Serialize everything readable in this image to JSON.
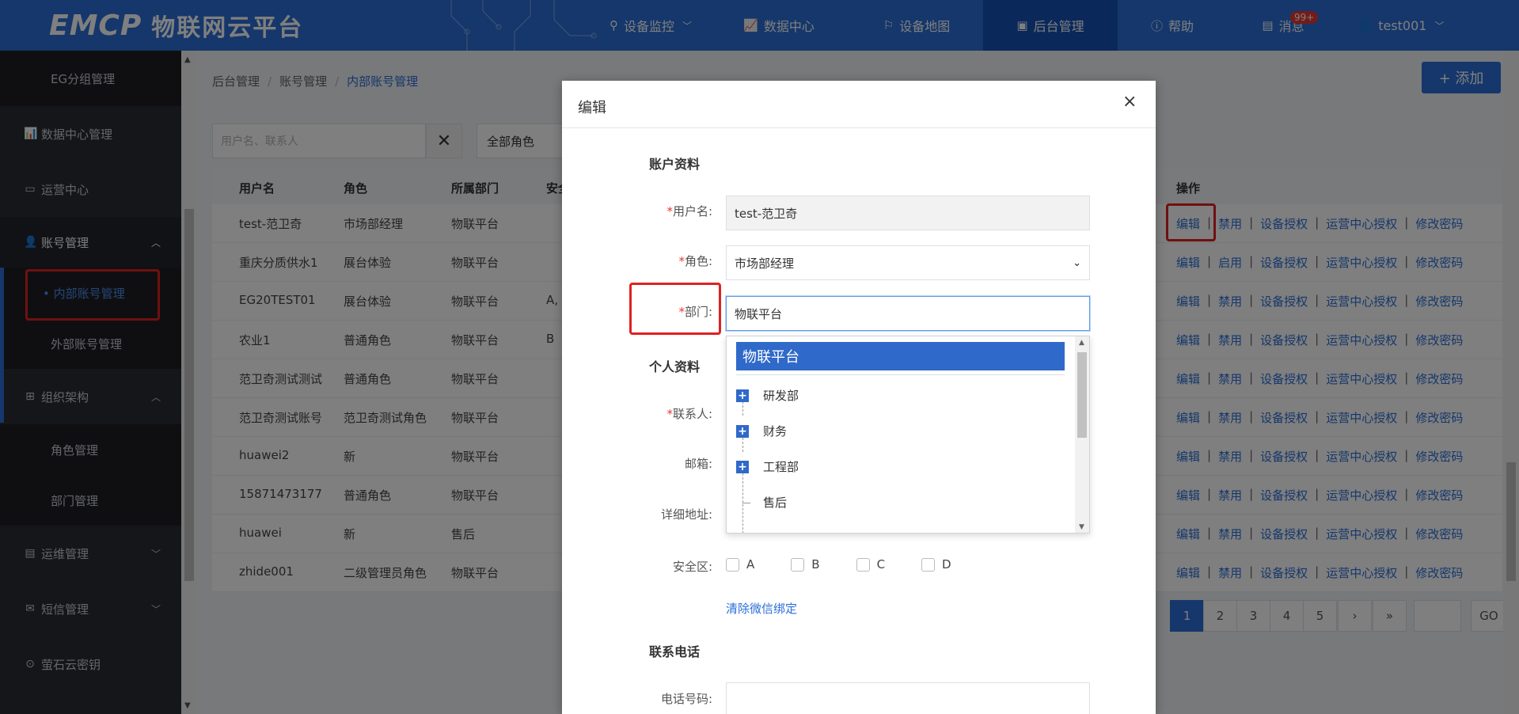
{
  "topbar": {
    "logo": "EMCP",
    "name": "物联网云平台",
    "nav": [
      {
        "label": "设备监控",
        "icon": "location-icon",
        "chevron": true
      },
      {
        "label": "数据中心",
        "icon": "chart-icon"
      },
      {
        "label": "设备地图",
        "icon": "map-pin-icon"
      },
      {
        "label": "后台管理",
        "icon": "monitor-icon",
        "active": true
      },
      {
        "label": "帮助",
        "icon": "help-icon"
      },
      {
        "label": "消息",
        "icon": "message-icon",
        "badge": "99+"
      },
      {
        "label": "test001",
        "icon": "user-icon",
        "chevron": true
      }
    ]
  },
  "sidebar": {
    "items": [
      {
        "label": "EG分组管理",
        "type": "sub"
      },
      {
        "label": "数据中心管理",
        "icon": "chart-icon"
      },
      {
        "label": "运营中心",
        "icon": "monitor-icon"
      },
      {
        "label": "账号管理",
        "icon": "user-icon",
        "expanded": true
      },
      {
        "label": "• 内部账号管理",
        "type": "sub",
        "active": true
      },
      {
        "label": "外部账号管理",
        "type": "sub"
      },
      {
        "label": "组织架构",
        "icon": "org-icon",
        "expanded": true
      },
      {
        "label": "角色管理",
        "type": "sub"
      },
      {
        "label": "部门管理",
        "type": "sub"
      },
      {
        "label": "运维管理",
        "icon": "doc-icon"
      },
      {
        "label": "短信管理",
        "icon": "sms-icon"
      },
      {
        "label": "萤石云密钥",
        "icon": "key-icon"
      }
    ]
  },
  "breadcrumb": [
    "后台管理",
    "账号管理",
    "内部账号管理"
  ],
  "add_button": "+ 添加",
  "search": {
    "placeholder": "用户名、联系人"
  },
  "role_filter": "全部角色",
  "table": {
    "headers": [
      "用户名",
      "角色",
      "所属部门",
      "安全",
      "操作"
    ],
    "rows": [
      {
        "user": "test-范卫奇",
        "role": "市场部经理",
        "dept": "物联平台",
        "sec": "",
        "toggle": "禁用"
      },
      {
        "user": "重庆分质供水1",
        "role": "展台体验",
        "dept": "物联平台",
        "sec": "",
        "toggle": "启用"
      },
      {
        "user": "EG20TEST01",
        "role": "展台体验",
        "dept": "物联平台",
        "sec": "A,",
        "toggle": "禁用"
      },
      {
        "user": "农业1",
        "role": "普通角色",
        "dept": "物联平台",
        "sec": "B",
        "toggle": "禁用"
      },
      {
        "user": "范卫奇测试测试",
        "role": "普通角色",
        "dept": "物联平台",
        "sec": "",
        "toggle": "禁用"
      },
      {
        "user": "范卫奇测试账号",
        "role": "范卫奇测试角色",
        "dept": "物联平台",
        "sec": "",
        "toggle": "禁用"
      },
      {
        "user": "huawei2",
        "role": "新",
        "dept": "物联平台",
        "sec": "",
        "toggle": "禁用"
      },
      {
        "user": "15871473177",
        "role": "普通角色",
        "dept": "物联平台",
        "sec": "",
        "toggle": "禁用"
      },
      {
        "user": "huawei",
        "role": "新",
        "dept": "售后",
        "sec": "",
        "toggle": "禁用"
      },
      {
        "user": "zhide001",
        "role": "二级管理员角色",
        "dept": "物联平台",
        "sec": "",
        "toggle": "禁用"
      }
    ],
    "ops": [
      "编辑",
      "设备授权",
      "运营中心授权",
      "修改密码"
    ]
  },
  "pager": {
    "pages": [
      "1",
      "2",
      "3",
      "4",
      "5",
      "›",
      "»"
    ],
    "current": "1",
    "go": "GO"
  },
  "modal": {
    "title": "编辑",
    "close": "×",
    "section_account": "账户资料",
    "section_personal": "个人资料",
    "section_phone": "联系电话",
    "username_label": "用户名:",
    "username_value": "test-范卫奇",
    "role_label": "角色:",
    "role_value": "市场部经理",
    "dept_label": "部门:",
    "dept_value": "物联平台",
    "contact_label": "联系人:",
    "email_label": "邮箱:",
    "address_label": "详细地址:",
    "security_label": "安全区:",
    "security_options": [
      "A",
      "B",
      "C",
      "D"
    ],
    "clear_wechat": "清除微信绑定",
    "phone_label": "电话号码:"
  },
  "dept_tree": {
    "root": "物联平台",
    "children": [
      {
        "label": "研发部",
        "expandable": true
      },
      {
        "label": "财务",
        "expandable": true
      },
      {
        "label": "工程部",
        "expandable": true
      },
      {
        "label": "售后",
        "expandable": false
      }
    ]
  },
  "colors": {
    "primary": "#2b6fd6",
    "sidebar": "#2b2d35",
    "highlight": "#e02020"
  }
}
